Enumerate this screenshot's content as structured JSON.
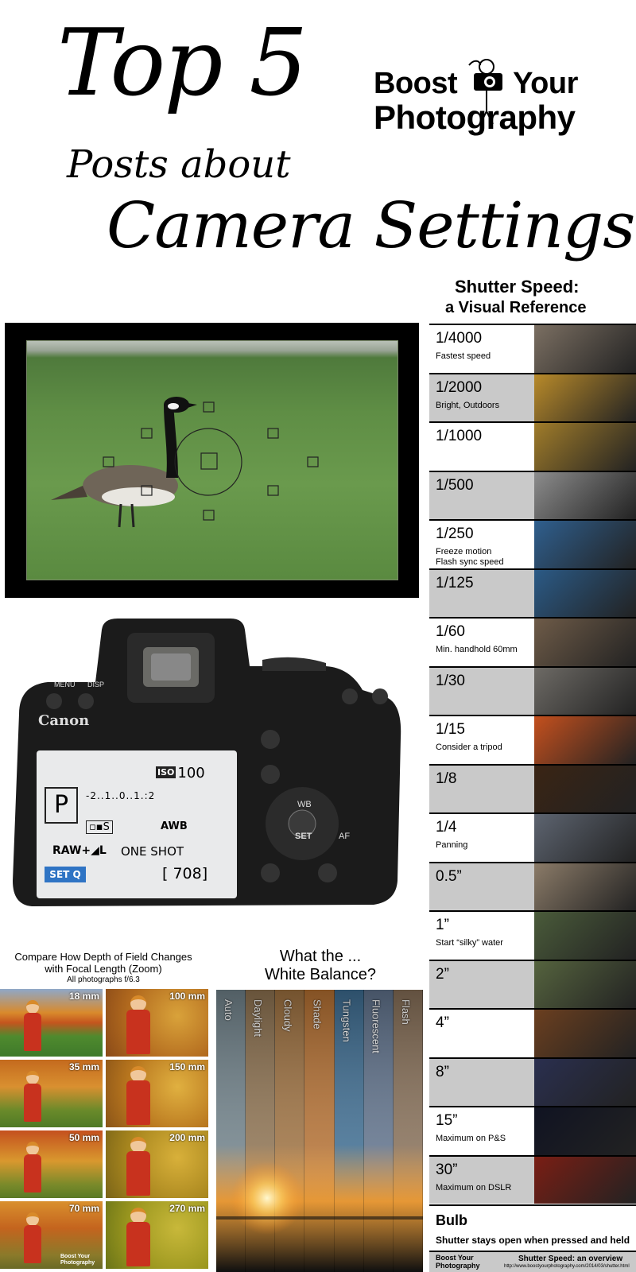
{
  "header": {
    "title_top": "Top 5",
    "title_posts": "Posts about",
    "title_topic": "Camera Settings"
  },
  "logo": {
    "line1_a": "Boost",
    "line1_b": "Your",
    "line2": "Photography"
  },
  "camera_lcd": {
    "brand": "Canon",
    "menu_label": "MENU",
    "disp_label": "DISP",
    "iso_label": "ISO",
    "iso_value": "100",
    "mode": "P",
    "exposure_scale": "-2..1..0..1.:2",
    "awb": "AWB",
    "quality": "RAW+◢L",
    "af_mode": "ONE SHOT",
    "set_q": "SET Q",
    "shots_remaining": "[ 708]",
    "wb_label": "WB",
    "af_label": "AF",
    "set_label": "SET"
  },
  "dof": {
    "title_line1": "Compare How Depth of Field Changes",
    "title_line2": "with Focal Length (Zoom)",
    "subtitle": "All photographs f/6.3",
    "cells": [
      "18 mm",
      "100 mm",
      "35 mm",
      "150 mm",
      "50 mm",
      "200 mm",
      "70 mm",
      "270 mm"
    ],
    "watermark_line1": "Boost Your",
    "watermark_line2": "Photography"
  },
  "white_balance": {
    "title_line1": "What the ...",
    "title_line2": "White Balance?",
    "strips": [
      {
        "label": "Auto",
        "color": "#6d7e86"
      },
      {
        "label": "Daylight",
        "color": "#8a6f4e"
      },
      {
        "label": "Cloudy",
        "color": "#9a6e3e"
      },
      {
        "label": "Shade",
        "color": "#b06d30"
      },
      {
        "label": "Tungsten",
        "color": "#3c6a8e"
      },
      {
        "label": "Fluorescent",
        "color": "#5d6f88"
      },
      {
        "label": "Flash",
        "color": "#836c55"
      }
    ]
  },
  "shutter": {
    "title_line1": "Shutter Speed:",
    "title_line2": "a Visual Reference",
    "rows": [
      {
        "speed": "1/4000",
        "note": "Fastest speed",
        "thumb": "#7b6f62"
      },
      {
        "speed": "1/2000",
        "note": "Bright, Outdoors",
        "thumb": "#b88a2a"
      },
      {
        "speed": "1/1000",
        "note": "",
        "thumb": "#a07c2a"
      },
      {
        "speed": "1/500",
        "note": "",
        "thumb": "#8c8c8c"
      },
      {
        "speed": "1/250",
        "note": "Freeze motion\nFlash sync speed",
        "thumb": "#2f5f8e"
      },
      {
        "speed": "1/125",
        "note": "",
        "thumb": "#2b5a86"
      },
      {
        "speed": "1/60",
        "note": "Min. handhold 60mm",
        "thumb": "#6e5b48"
      },
      {
        "speed": "1/30",
        "note": "",
        "thumb": "#6d6a65"
      },
      {
        "speed": "1/15",
        "note": "Consider a tripod",
        "thumb": "#c4501e"
      },
      {
        "speed": "1/8",
        "note": "",
        "thumb": "#3a2414"
      },
      {
        "speed": "1/4",
        "note": "Panning",
        "thumb": "#5d6470"
      },
      {
        "speed": "0.5”",
        "note": "",
        "thumb": "#8b7b68"
      },
      {
        "speed": "1”",
        "note": "Start “silky” water",
        "thumb": "#4a5b3a"
      },
      {
        "speed": "2”",
        "note": "",
        "thumb": "#55633e"
      },
      {
        "speed": "4”",
        "note": "",
        "thumb": "#6b3f1f"
      },
      {
        "speed": "8”",
        "note": "",
        "thumb": "#2a2f4f"
      },
      {
        "speed": "15”",
        "note": "Maximum on P&S",
        "thumb": "#101322"
      },
      {
        "speed": "30”",
        "note": "Maximum on DSLR",
        "thumb": "#7a1e14"
      }
    ],
    "bulb_label": "Bulb",
    "bulb_note": "Shutter stays open when pressed and held",
    "footer_brand_line1": "Boost Your",
    "footer_brand_line2": "Photography",
    "footer_title": "Shutter Speed: an overview",
    "footer_url": "http://www.boostyourphotography.com/2014/03/shutter.html"
  },
  "colors": {
    "setq_blue": "#2f74c4",
    "row_gray": "#c9c9c9"
  }
}
